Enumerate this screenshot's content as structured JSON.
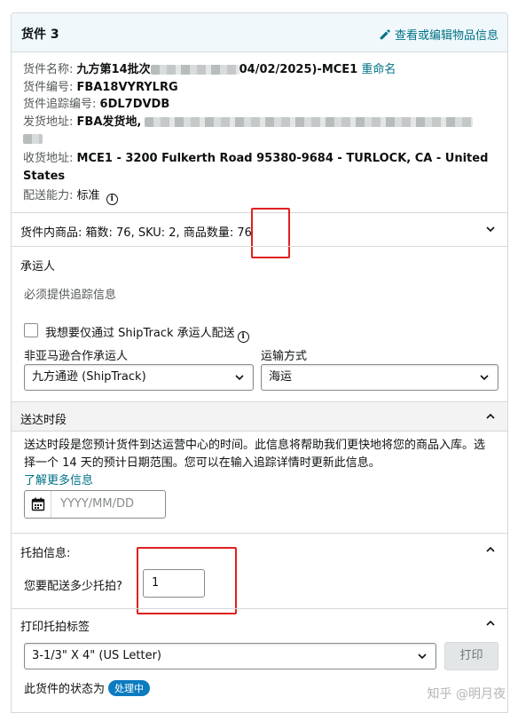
{
  "header": {
    "title": "货件 3",
    "edit_link": "查看或编辑物品信息"
  },
  "shipment_info": {
    "name_label": "货件名称:",
    "name_value_start": "九方第14批次",
    "name_value_end": "04/02/2025)-MCE1",
    "rename_link": "重命名",
    "id_label": "货件编号:",
    "id_value": "FBA18VYRYLRG",
    "tracking_label": "货件追踪编号:",
    "tracking_value": "6DL7DVDB",
    "ship_from_label": "发货地址:",
    "ship_from_value": "FBA发货地,",
    "ship_to_label": "收货地址:",
    "ship_to_value": "MCE1 - 3200 Fulkerth Road 95380-9684 - TURLOCK, CA - United States",
    "capability_label": "配送能力:",
    "capability_value": "标准"
  },
  "contents_summary": {
    "text": "货件内商品: 箱数: 76, SKU: 2, 商品数量: ",
    "quantity": "76"
  },
  "carrier": {
    "section_label": "承运人",
    "tracking_required": "必须提供追踪信息",
    "shiptrack_checkbox_label": "我想要仅通过 ShipTrack 承运人配送",
    "non_amazon_carrier_label": "非亚马逊合作承运人",
    "non_amazon_carrier_value": "九方通逊 (ShipTrack)",
    "shipping_method_label": "运输方式",
    "shipping_method_value": "海运"
  },
  "delivery_window": {
    "title": "送达时段",
    "description": "送达时段是您预计货件到达运营中心的时间。此信息将帮助我们更快地将您的商品入库。选择一个 14 天的预计日期范围。您可以在输入追踪详情时更新此信息。",
    "learn_more": "了解更多信息",
    "date_placeholder": "YYYY/MM/DD"
  },
  "pallet_info": {
    "title": "托拍信息:",
    "question": "您要配送多少托拍?",
    "count": "1"
  },
  "pallet_labels": {
    "title": "打印托拍标签",
    "label_size_value": "3-1/3\" X 4\" (US Letter)",
    "print_button": "打印"
  },
  "status": {
    "label": "此货件的状态为",
    "badge": "处理中"
  },
  "watermark": "知乎 @明月夜",
  "colors": {
    "link": "#007185",
    "header_bg": "#f0f8fc",
    "band_bg": "#f3f3f3",
    "badge_bg": "#0c7bc0",
    "highlight_box": "#e02020"
  }
}
